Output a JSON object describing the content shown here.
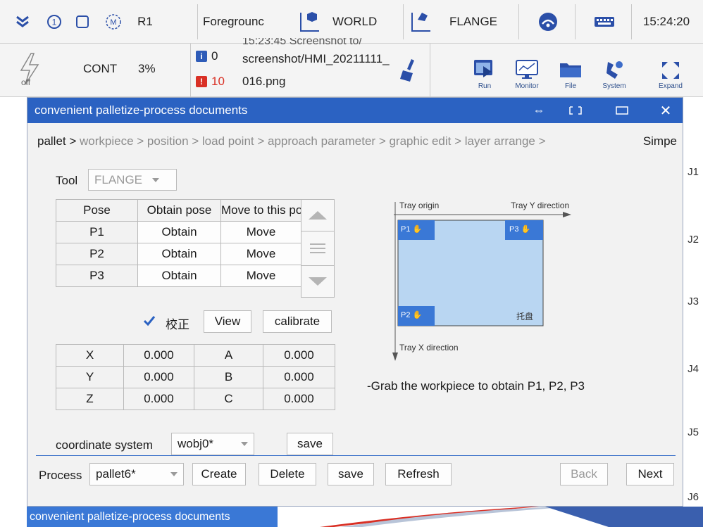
{
  "topbar": {
    "robot": "R1",
    "mode": "Foregrounc",
    "coord_frame": "WORLD",
    "tool_frame": "FLANGE",
    "time": "15:24:20"
  },
  "statusbar": {
    "run_mode": "CONT",
    "speed": "3%",
    "power_state": "off",
    "info_count": "0",
    "error_count": "10",
    "message_line1": "15:23:45 Screenshot to/",
    "message_line2": "screenshot/HMI_20211111_",
    "message_line3": "016.png",
    "tools": [
      "Run",
      "Monitor",
      "File",
      "System",
      "Expand"
    ]
  },
  "joints": [
    "J1",
    "J2",
    "J3",
    "J4",
    "J5",
    "J6"
  ],
  "dialog": {
    "title": "convenient palletize-process documents",
    "breadcrumb_current": "pallet >",
    "breadcrumb_rest": " workpiece > position > load point > approach parameter > graphic edit > layer arrange >",
    "breadcrumb_right": "Simpe",
    "tool_label": "Tool",
    "tool_value": "FLANGE",
    "pose_table": {
      "headers": [
        "Pose",
        "Obtain pose",
        "Move to this pos"
      ],
      "rows": [
        {
          "pose": "P1",
          "obtain": "Obtain",
          "move": "Move"
        },
        {
          "pose": "P2",
          "obtain": "Obtain",
          "move": "Move"
        },
        {
          "pose": "P3",
          "obtain": "Obtain",
          "move": "Move"
        }
      ]
    },
    "calibrate_checkbox_label": "校正",
    "view_button": "View",
    "calibrate_button": "calibrate",
    "coords": [
      {
        "axis1": "X",
        "val1": "0.000",
        "axis2": "A",
        "val2": "0.000"
      },
      {
        "axis1": "Y",
        "val1": "0.000",
        "axis2": "B",
        "val2": "0.000"
      },
      {
        "axis1": "Z",
        "val1": "0.000",
        "axis2": "C",
        "val2": "0.000"
      }
    ],
    "coord_system_label": "coordinate system",
    "coord_system_value": "wobj0*",
    "save_button": "save",
    "diagram": {
      "origin_label": "Tray origin",
      "y_dir_label": "Tray Y direction",
      "x_dir_label": "Tray X direction",
      "tray_label": "托盘",
      "p1": "P1",
      "p2": "P2",
      "p3": "P3"
    },
    "hint": "-Grab the workpiece to obtain P1, P2, P3",
    "footer": {
      "process_label": "Process",
      "process_value": "pallet6*",
      "create": "Create",
      "delete": "Delete",
      "save": "save",
      "refresh": "Refresh",
      "back": "Back",
      "next": "Next"
    }
  },
  "bottom_tab": "convenient palletize-process documents",
  "colors": {
    "accent": "#2b62c2",
    "marker": "#3a78d6",
    "tray_fill": "#b9d6f2",
    "error": "#d93025",
    "info": "#2e5cb8"
  }
}
